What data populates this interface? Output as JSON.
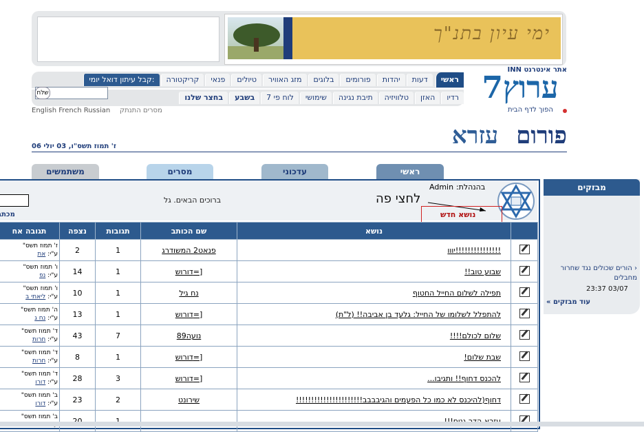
{
  "banner": {
    "text": "ימי עיון בתנ\"ך"
  },
  "logo": {
    "top_text": "אתר אינטרנט INN",
    "main": "ערוץ7",
    "home_link": "הפוך לדף הבית"
  },
  "nav": {
    "row1": [
      "ראשי",
      "דעות",
      "יהדות",
      "פורומים",
      "בלוגים",
      "מזג האוויר",
      "טיולים",
      "פנאי",
      "קריקטורה"
    ],
    "subscribe_label": "קבל עיתון דואל יומי:",
    "row2": [
      "רדיו",
      "האזן",
      "טלוויזיה",
      "תיבת נגינה",
      "שימושי",
      "לוח פי 7",
      "בשבע",
      "בחצר שלנו"
    ],
    "send_label": "שלח"
  },
  "langs": "English  French  Russian",
  "langs_he": "מסרים  התנתק",
  "forum": {
    "title": "פורום",
    "name": "עזרא",
    "date": "ז' תמוז תשס\"ו, 03 יולי 06"
  },
  "tabs": {
    "main": "ראשי",
    "updates": "עדכוני",
    "messages": "מסרים",
    "users": "משתמשים"
  },
  "head": {
    "mgmt_label": "בהנהלת:",
    "mgmt_value": "Admin",
    "welcome": "ברוכים הבאים. גל",
    "writer": "מכתב",
    "new_topic": "נושא חדש",
    "annotation": "לחצי פה"
  },
  "columns": [
    "נושא",
    "שם הכותב",
    "תגובות",
    "נצפה",
    "תגובה אח"
  ],
  "rows": [
    {
      "subject": "!!!!!!!!!!!!!!!יווו",
      "author": "פנאט2 המשודרג",
      "replies": "1",
      "views": "2",
      "last_date": "ז' תמוז תשס\"",
      "last_by": "את"
    },
    {
      "subject": "שבוע טוב!!",
      "author": "דורוש=]",
      "replies": "1",
      "views": "14",
      "last_date": "ו' תמוז תשס\"",
      "last_by": "נפ"
    },
    {
      "subject": "תפילה לשלום החייל החטוף",
      "author": "נח גיל",
      "replies": "1",
      "views": "10",
      "last_date": "ו' תמוז תשס\"",
      "last_by": "ליאתי ב"
    },
    {
      "subject": "להתפלל לשלומו של החייל: גלעד בן אביבה!! (ל\"ת)",
      "author": "דורוש=]",
      "replies": "1",
      "views": "13",
      "last_date": "ה' תמוז תשס\"",
      "last_by": "נח ג"
    },
    {
      "subject": "שלום לכולם!!!!",
      "author": "נועה89",
      "replies": "7",
      "views": "43",
      "last_date": "ד' תמוז תשס\"",
      "last_by": "חרות"
    },
    {
      "subject": "שבת שלום!",
      "author": "דורוש=]",
      "replies": "1",
      "views": "8",
      "last_date": "ד' תמוז תשס\"",
      "last_by": "חרות"
    },
    {
      "subject": "להכנס דחוף!! ותגיבו...",
      "author": "דורוש=]",
      "replies": "3",
      "views": "28",
      "last_date": "ד' תמוז תשס\"",
      "last_by": "דורו"
    },
    {
      "subject": "דחוף(להיכנס לא כמו כל הפעמים והגיבבבב!!!!!!!!!!!!!!!!!!!!!!",
      "author": "שירונט",
      "replies": "2",
      "views": "23",
      "last_date": "ב' תמוז תשס\"",
      "last_by": "דורו"
    },
    {
      "subject": "עזרא הדר גניח!!!",
      "author": "",
      "replies": "1",
      "views": "20",
      "last_date": "ב' תמוז תשס\"",
      "last_by": ""
    }
  ],
  "by_prefix": "ע\"י:",
  "side": {
    "title": "מבזקים",
    "item": "הורים שכולים נגד שחרור מחבלים",
    "time": "23:37 03/07",
    "more": "עוד מבזקים"
  }
}
